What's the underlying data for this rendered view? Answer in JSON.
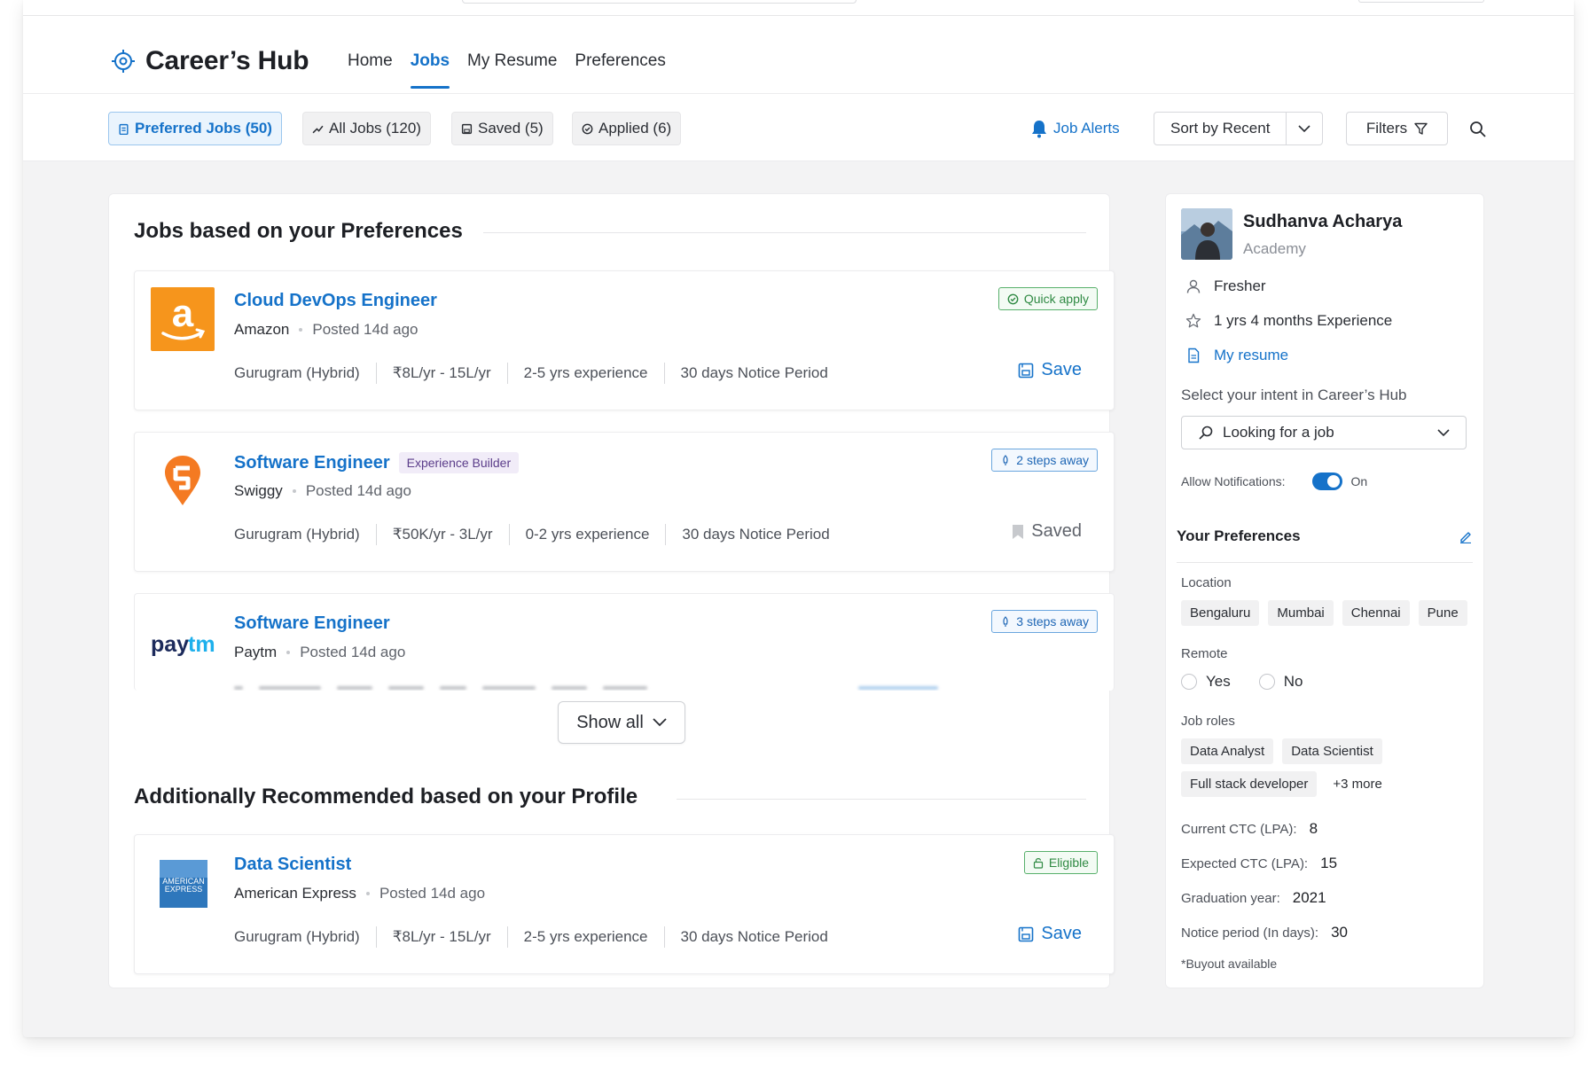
{
  "brand": {
    "title": "Career’s Hub",
    "accent": "#1572c9"
  },
  "nav": {
    "items": [
      "Home",
      "Jobs",
      "My Resume",
      "Preferences"
    ],
    "active": "Jobs"
  },
  "toolbar": {
    "chips": [
      {
        "label": "Preferred Jobs (50)",
        "icon": "clipboard-icon",
        "selected": true
      },
      {
        "label": "All Jobs (120)",
        "icon": "trend-icon",
        "selected": false
      },
      {
        "label": "Saved (5)",
        "icon": "save-icon",
        "selected": false
      },
      {
        "label": "Applied (6)",
        "icon": "check-circle-icon",
        "selected": false
      }
    ],
    "job_alerts": "Job Alerts",
    "sort_label": "Sort by Recent",
    "filters_label": "Filters"
  },
  "main": {
    "section1_title": "Jobs based on your Preferences",
    "section2_title": "Additionally Recommended based on your Profile",
    "show_all": "Show all",
    "jobs": [
      {
        "title": "Cloud DevOps Engineer",
        "tag": "",
        "company": "Amazon",
        "posted": "Posted 14d ago",
        "location": "Gurugram (Hybrid)",
        "salary": "₹8L/yr - 15L/yr",
        "experience": "2-5 yrs experience",
        "notice": "30 days Notice Period",
        "badge": "Quick apply",
        "badge_style": "green",
        "action": "Save",
        "saved": false
      },
      {
        "title": "Software Engineer",
        "tag": "Experience Builder",
        "company": "Swiggy",
        "posted": "Posted 14d ago",
        "location": "Gurugram (Hybrid)",
        "salary": "₹50K/yr - 3L/yr",
        "experience": "0-2 yrs experience",
        "notice": "30 days Notice Period",
        "badge": "2 steps away",
        "badge_style": "blue",
        "action": "Saved",
        "saved": true
      },
      {
        "title": "Software Engineer",
        "tag": "",
        "company": "Paytm",
        "posted": "Posted 14d ago",
        "badge": "3 steps away",
        "badge_style": "blue"
      }
    ],
    "recommended": [
      {
        "title": "Data Scientist",
        "company": "American Express",
        "posted": "Posted 14d ago",
        "location": "Gurugram (Hybrid)",
        "salary": "₹8L/yr - 15L/yr",
        "experience": "2-5 yrs experience",
        "notice": "30 days Notice Period",
        "badge": "Eligible",
        "badge_style": "green",
        "action": "Save",
        "saved": false
      }
    ]
  },
  "profile": {
    "name": "Sudhanva Acharya",
    "org": "Academy",
    "level": "Fresher",
    "experience": "1 yrs 4 months Experience",
    "resume_link": "My resume",
    "intent_label": "Select your intent in Career’s Hub",
    "intent_value": "Looking for a job",
    "notifications_label": "Allow Notifications:",
    "notifications_state": "On",
    "preferences_title": "Your Preferences",
    "location_label": "Location",
    "locations": [
      "Bengaluru",
      "Mumbai",
      "Chennai",
      "Pune"
    ],
    "remote_label": "Remote",
    "remote_options": [
      "Yes",
      "No"
    ],
    "roles_label": "Job roles",
    "roles": [
      "Data Analyst",
      "Data Scientist",
      "Full stack developer"
    ],
    "roles_more": "+3 more",
    "current_ctc_label": "Current CTC (LPA):",
    "current_ctc": "8",
    "expected_ctc_label": "Expected CTC (LPA):",
    "expected_ctc": "15",
    "grad_label": "Graduation year:",
    "grad_year": "2021",
    "notice_label": "Notice period (In days):",
    "notice_days": "30",
    "buyout_note": "*Buyout available"
  }
}
